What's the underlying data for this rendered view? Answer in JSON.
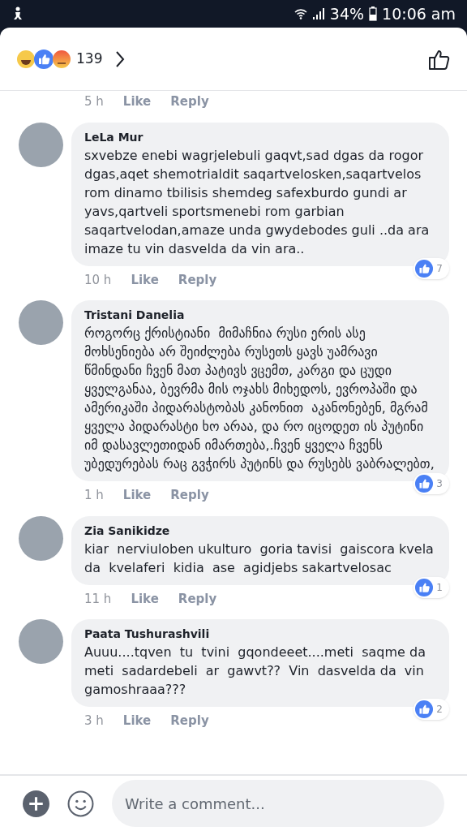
{
  "status_bar": {
    "battery": "34%",
    "time": "10:06 am"
  },
  "header": {
    "reaction_count": "139"
  },
  "previous_comment": {
    "time": "5 h",
    "like": "Like",
    "reply": "Reply"
  },
  "comments": [
    {
      "author": "LeLa Mur",
      "text": "sxvebze enebi wagrjelebuli gaqvt,sad dgas da rogor dgas,aqet shemotrialdit saqartvelosken,saqartvelos rom dinamo tbilisis shemdeg safexburdo gundi ar yavs,qartveli sportsmenebi rom garbian saqartvelodan,amaze unda gwydebodes guli ..da ara imaze tu vin dasvelda da vin ara..",
      "time": "10 h",
      "like": "Like",
      "reply": "Reply",
      "likes": "7"
    },
    {
      "author": "Tristani Danelia",
      "text": "როგორც ქრისტიანი  მიმაჩნია რუსი ერის ასე მოხსენიება არ შეიძლება რუსეთს ყავს უამრავი წმინდანი ჩვენ მათ პატივს ვცემთ, კარგი და ცუდი ყველგანაა, ბევრმა მის ოჯახს მიხედოს, ევროპაში და ამერიკაში პიდარასტობას კანონით  აკანონებენ, მგრამ ყველა პიდარასტი ხო არაა, და რო იცოდეთ ის პუტინი იმ დასავლეთიდან იმართება,.ჩვენ ყველა ჩვენს უბედურებას რაც გვჭირს პუტინს და რუსებს ვაბრალებთ,",
      "time": "1 h",
      "like": "Like",
      "reply": "Reply",
      "likes": "3"
    },
    {
      "author": "Zia Sanikidze",
      "text": "kiar  nerviuloben ukulturo  goria tavisi  gaiscora kvela  da  kvelaferi  kidia  ase  agidjebs sakartvelosac",
      "time": "11 h",
      "like": "Like",
      "reply": "Reply",
      "likes": "1"
    },
    {
      "author": "Paata Tushurashvili",
      "text": "Auuu....tqven  tu  tvini  gqondeeet....meti  saqme da  meti  sadardebeli  ar  gawvt??  Vin  dasvelda da  vin   gamoshraaa???",
      "time": "3 h",
      "like": "Like",
      "reply": "Reply",
      "likes": "2"
    }
  ],
  "composer": {
    "placeholder": "Write a comment..."
  }
}
